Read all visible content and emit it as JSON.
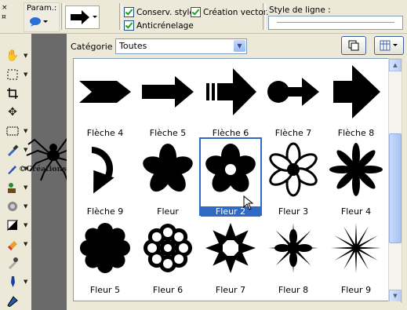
{
  "options_bar": {
    "grip_glyphs": [
      "×",
      "¤"
    ],
    "param_label": "Param.:",
    "conserv_style_label": "Conserv. style",
    "creation_vector_label": "Création vector.",
    "anticrenelage_label": "Anticrénelage",
    "line_style_label": "Style de ligne :"
  },
  "toolbar": {
    "tools": [
      "pan-icon",
      "selection-icon",
      "crop-icon",
      "move-icon",
      "rect-select-icon",
      "eyedropper-icon",
      "brush-icon",
      "clone-icon",
      "retouch-icon",
      "fill-icon",
      "eraser-icon",
      "dropper-icon",
      "pen-icon",
      "paint-icon"
    ]
  },
  "watermark": {
    "text": "©Créations Claudia"
  },
  "dialog": {
    "category_label": "Catégorie :",
    "category_value": "Toutes"
  },
  "shapes": [
    {
      "name": "Flèche 4",
      "icon": "chevron-arrow"
    },
    {
      "name": "Flèche 5",
      "icon": "block-arrow"
    },
    {
      "name": "Flèche 6",
      "icon": "striped-arrow"
    },
    {
      "name": "Flèche 7",
      "icon": "pin-arrow"
    },
    {
      "name": "Flèche 8",
      "icon": "fat-arrow"
    },
    {
      "name": "Flèche 9",
      "icon": "curved-arrow"
    },
    {
      "name": "Fleur",
      "icon": "flower-5-petal"
    },
    {
      "name": "Fleur 2",
      "icon": "flower-ring"
    },
    {
      "name": "Fleur 3",
      "icon": "flower-outline"
    },
    {
      "name": "Fleur 4",
      "icon": "flower-8-spoke"
    },
    {
      "name": "Fleur 5",
      "icon": "flower-cloud"
    },
    {
      "name": "Fleur 6",
      "icon": "flower-daisy"
    },
    {
      "name": "Fleur 7",
      "icon": "flower-star"
    },
    {
      "name": "Fleur 8",
      "icon": "flower-8-thin"
    },
    {
      "name": "Fleur 9",
      "icon": "flower-sparkle"
    }
  ],
  "selected_shape": "Fleur 2",
  "colors": {
    "selection": "#316ac5",
    "panel_bg": "#ece9d8",
    "dark_strip": "#6a6a6a"
  }
}
